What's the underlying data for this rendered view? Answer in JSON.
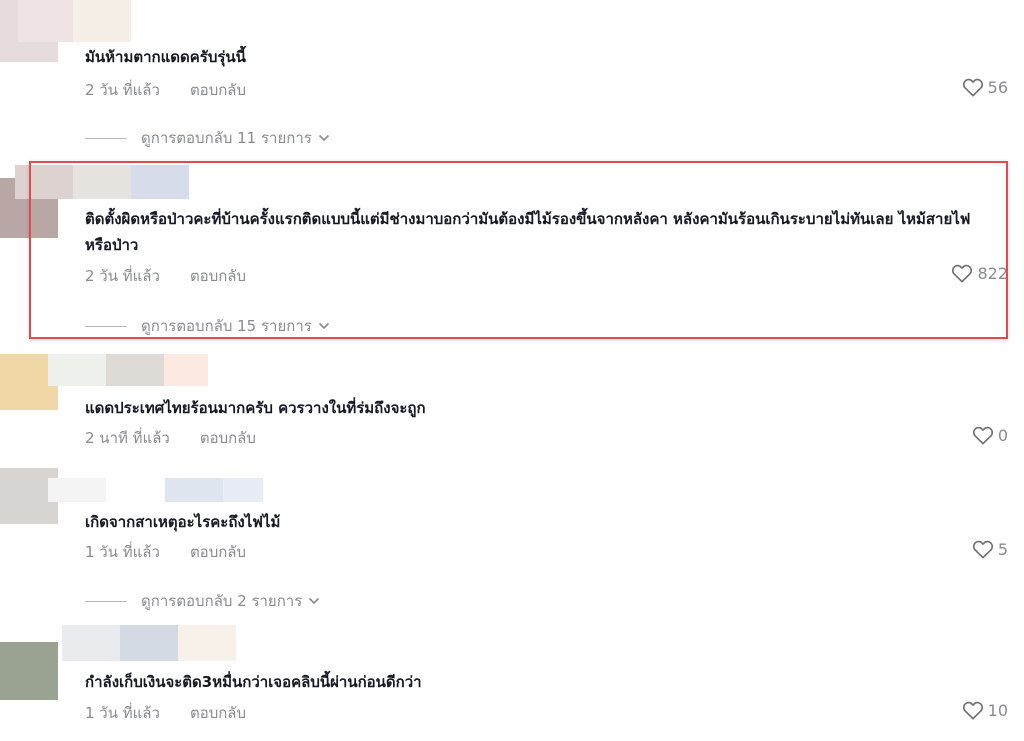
{
  "comments": [
    {
      "text": "มันห้ามตากแดดครับรุ่นนี้",
      "time": "2 วัน ที่แล้ว",
      "reply_label": "ตอบกลับ",
      "likes": "56",
      "view_replies": "ดูการตอบกลับ 11 รายการ"
    },
    {
      "text": "ติดตั้งผิดหรือป่าวคะที่บ้านครั้งแรกติดแบบนี้แต่มีช่างมาบอกว่ามันต้องมีไม้รองขึ้นจากหลังคา หลังคามันร้อนเกินระบายไม่ทันเลย ไหม้สายไฟหรือป่าว",
      "time": "2 วัน ที่แล้ว",
      "reply_label": "ตอบกลับ",
      "likes": "822",
      "view_replies": "ดูการตอบกลับ 15 รายการ"
    },
    {
      "text": "แดดประเทศไทยร้อนมากครับ ควรวางในที่ร่มถึงจะถูก",
      "time": "2 นาที ที่แล้ว",
      "reply_label": "ตอบกลับ",
      "likes": "0"
    },
    {
      "text": "เกิดจากสาเหตุอะไรคะถึงไฟไม้",
      "time": "1 วัน ที่แล้ว",
      "reply_label": "ตอบกลับ",
      "likes": "5",
      "view_replies": "ดูการตอบกลับ 2 รายการ"
    },
    {
      "text": "กำลังเก็บเงินจะติด3หมื่นกว่าเจอคลิบนี้ผ่านก่อนดีกว่า",
      "time": "1 วัน ที่แล้ว",
      "reply_label": "ตอบกลับ",
      "likes": "10"
    }
  ],
  "icons": {
    "like": "heart-outline-icon",
    "expand": "chevron-down-icon"
  },
  "colors": {
    "highlight_border": "#e04b4b",
    "meta_text": "#8a8b91",
    "comment_text": "#161823"
  }
}
